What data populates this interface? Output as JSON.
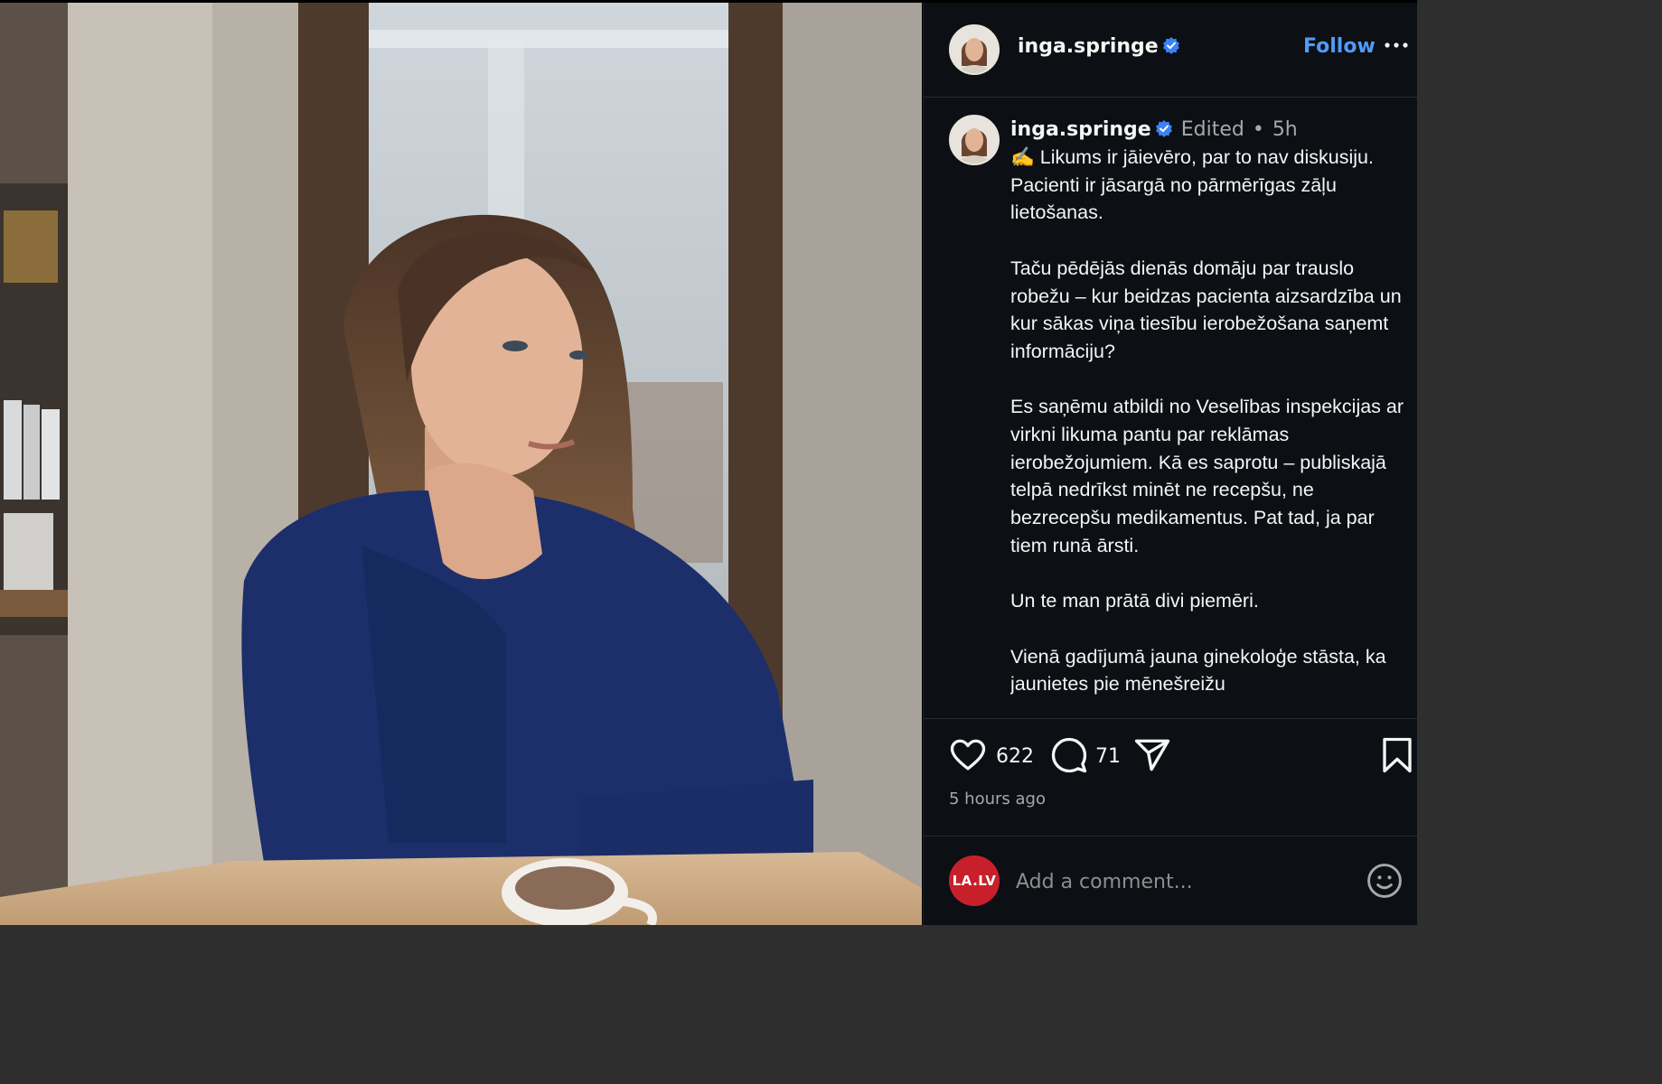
{
  "post": {
    "author": {
      "username": "inga.springe",
      "verified": true,
      "follow_label": "Follow",
      "more_icon": "more-horizontal-icon"
    },
    "caption": {
      "username": "inga.springe",
      "edited_label": "Edited",
      "separator": "•",
      "time_ago": "5h",
      "text": "✍️ Likums ir jāievēro, par to nav diskusiju. Pacienti ir jāsargā no pārmērīgas zāļu lietošanas.\n\nTaču pēdējās dienās domāju par trauslo robežu – kur beidzas pacienta aizsardzība un kur sākas viņa tiesību ierobežošana saņemt informāciju?\n\nEs saņēmu atbildi no Veselības inspekcijas ar virkni likuma pantu par reklāmas ierobežojumiem. Kā es saprotu – publiskajā telpā nedrīkst minēt ne recepšu, ne bezrecepšu medikamentus. Pat tad, ja par tiem runā ārsti.\n\nUn te man prātā divi piemēri.\n\nVienā gadījumā jauna ginekoloģe stāsta, ka jaunietes pie mēnešreižu"
    },
    "actions": {
      "likes": "622",
      "comments": "71",
      "like_icon": "heart-icon",
      "comment_icon": "comment-bubble-icon",
      "share_icon": "send-icon",
      "save_icon": "bookmark-icon"
    },
    "timestamp": "5 hours ago",
    "comment_box": {
      "avatar_text": "LA.LV",
      "placeholder": "Add a comment...",
      "emoji_icon": "smiley-icon"
    }
  },
  "colors": {
    "sidebar_bg": "#0c0f14",
    "accent": "#4f9cf9",
    "verified_badge": "#3b82f6",
    "brand_red": "#c8202b"
  }
}
